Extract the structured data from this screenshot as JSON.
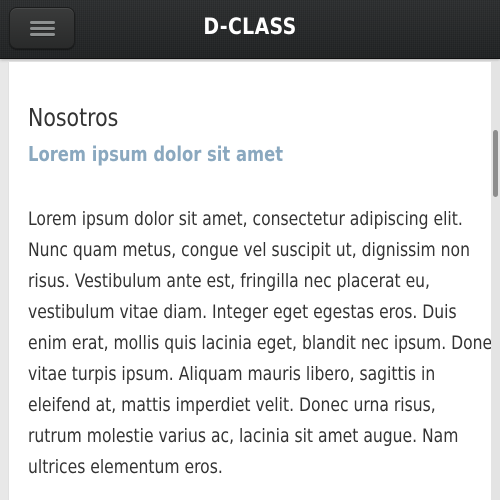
{
  "header": {
    "menu_icon": "hamburger-menu-icon",
    "title": "D-CLASS"
  },
  "content": {
    "title": "Nosotros",
    "subtitle": "Lorem ipsum dolor sit amet",
    "body_lines": [
      "Lorem ipsum dolor sit amet, consectetur adipiscing elit.",
      "Nunc quam metus, congue vel suscipit ut, dignissim non",
      "risus. Vestibulum ante est, fringilla nec placerat eu,",
      "vestibulum vitae diam. Integer eget egestas eros. Duis",
      "enim erat, mollis quis lacinia eget, blandit nec ipsum. Donec",
      "vitae turpis ipsum. Aliquam mauris libero, sagittis in",
      "eleifend at, mattis imperdiet velit. Donec urna risus,",
      "rutrum molestie varius ac, lacinia sit amet augue. Nam",
      "ultrices elementum eros."
    ]
  },
  "colors": {
    "header_background": "#252728",
    "header_title": "#ffffff",
    "page_background": "#e8e8e8",
    "content_background": "#ffffff",
    "title_text": "#333333",
    "subtitle_text": "#8aa8bf",
    "body_text": "#333333",
    "scrollbar_thumb": "#8d8d8d"
  }
}
